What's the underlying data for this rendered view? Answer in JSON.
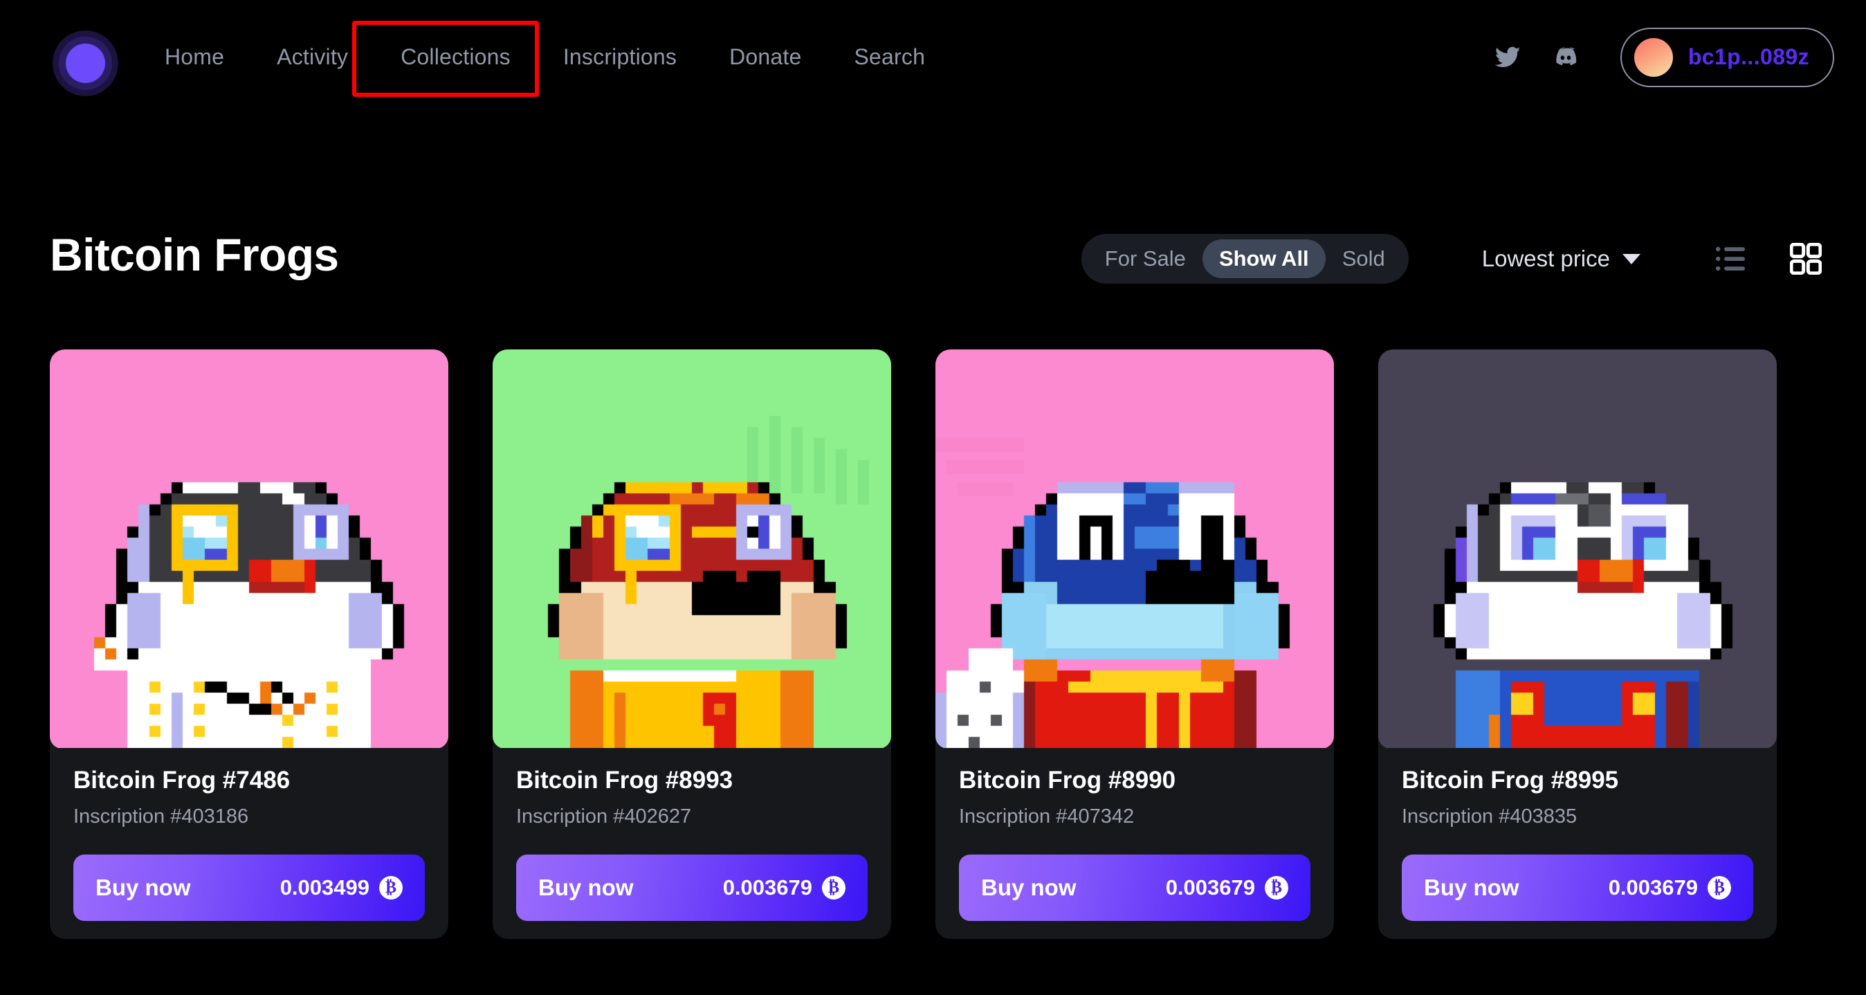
{
  "header": {
    "logo_icon": "orb-logo-icon",
    "nav": [
      {
        "label": "Home"
      },
      {
        "label": "Activity"
      },
      {
        "label": "Collections",
        "highlighted": true
      },
      {
        "label": "Inscriptions"
      },
      {
        "label": "Donate"
      },
      {
        "label": "Search"
      }
    ],
    "socials": [
      {
        "icon": "twitter-icon"
      },
      {
        "icon": "discord-icon"
      }
    ],
    "wallet": {
      "address": "bc1p...089z",
      "avatar_icon": "wallet-avatar"
    },
    "highlight_color": "#ff0000"
  },
  "page": {
    "title": "Bitcoin Frogs"
  },
  "controls": {
    "segments": [
      {
        "label": "For Sale",
        "active": false
      },
      {
        "label": "Show All",
        "active": true
      },
      {
        "label": "Sold",
        "active": false
      }
    ],
    "sort": {
      "label": "Lowest price",
      "caret_icon": "chevron-down-icon"
    },
    "views": [
      {
        "icon": "list-view-icon",
        "active": false
      },
      {
        "icon": "grid-view-icon",
        "active": true
      }
    ]
  },
  "cards": [
    {
      "title": "Bitcoin Frog #7486",
      "inscription": "Inscription #403186",
      "buy_label": "Buy now",
      "price": "0.003499",
      "currency_icon": "bitcoin-icon",
      "bg_color": "#fb8ad0"
    },
    {
      "title": "Bitcoin Frog #8993",
      "inscription": "Inscription #402627",
      "buy_label": "Buy now",
      "price": "0.003679",
      "currency_icon": "bitcoin-icon",
      "bg_color": "#8df08d"
    },
    {
      "title": "Bitcoin Frog #8990",
      "inscription": "Inscription #407342",
      "buy_label": "Buy now",
      "price": "0.003679",
      "currency_icon": "bitcoin-icon",
      "bg_color": "#fb8ad0"
    },
    {
      "title": "Bitcoin Frog #8995",
      "inscription": "Inscription #403835",
      "buy_label": "Buy now",
      "price": "0.003679",
      "currency_icon": "bitcoin-icon",
      "bg_color": "#474355"
    }
  ],
  "colors": {
    "page_bg": "#000000",
    "card_bg": "#17181c",
    "accent_purple": "#5b2cf5",
    "muted_text": "#9aa1ad"
  }
}
